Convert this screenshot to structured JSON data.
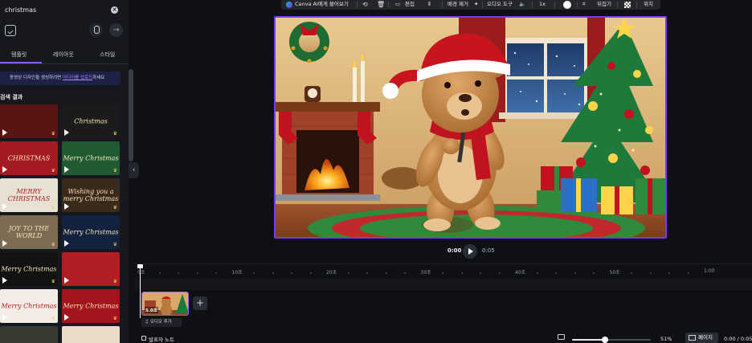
{
  "search": {
    "query": "christmas"
  },
  "tabs": [
    {
      "label": "템플릿"
    },
    {
      "label": "레이아웃"
    },
    {
      "label": "스타일"
    }
  ],
  "banner": {
    "text": "동영상 디자인을 생성하려면 ",
    "link": "미디어를 업로드",
    "suffix": "하세요"
  },
  "results": {
    "title": "검색 결과"
  },
  "thumbnails": [
    {
      "title": "",
      "bg": "#5a1414"
    },
    {
      "title": "Christmas",
      "bg": "#1b1b1b"
    },
    {
      "title": "CHRISTMAS",
      "bg": "#a31a22"
    },
    {
      "title": "Merry Christmas",
      "bg": "#1f5a33"
    },
    {
      "title": "MERRY CHRISTMAS",
      "bg": "#e8e0d2"
    },
    {
      "title": "Wishing you a merry Christmas",
      "bg": "#3a2a1c"
    },
    {
      "title": "JOY TO THE WORLD",
      "bg": "#7c6c54"
    },
    {
      "title": "Merry Christmas",
      "bg": "#13233f"
    },
    {
      "title": "Merry Christmas",
      "bg": "#121212"
    },
    {
      "title": "",
      "bg": "#b01e24"
    },
    {
      "title": "Merry Christmas",
      "bg": "#f2ece4"
    },
    {
      "title": "Merry Christmas",
      "bg": "#a4141c"
    },
    {
      "title": "",
      "bg": "#3a3a30"
    },
    {
      "title": "",
      "bg": "#e8dcc8"
    }
  ],
  "toolbar": {
    "ask_canva": "Canva AI에게 물어보기",
    "edit": "편집",
    "bg_remove": "배경 제거",
    "audio_tools": "오디오 도구",
    "speed": "1x",
    "flip": "뒤집기",
    "position": "위치"
  },
  "playback": {
    "current": "0:00",
    "total": "0:05"
  },
  "timeline": {
    "ticks": [
      "0초",
      "10초",
      "20초",
      "30초",
      "40초",
      "50초",
      "1:00"
    ],
    "clip_label": "5.0초",
    "audio_add": "오디오 추가"
  },
  "bottom": {
    "notes": "발표자 노트",
    "zoom_pct": "51%",
    "zoom_value": 0.51,
    "page": "페이지",
    "time": "0:00 / 0:05"
  }
}
